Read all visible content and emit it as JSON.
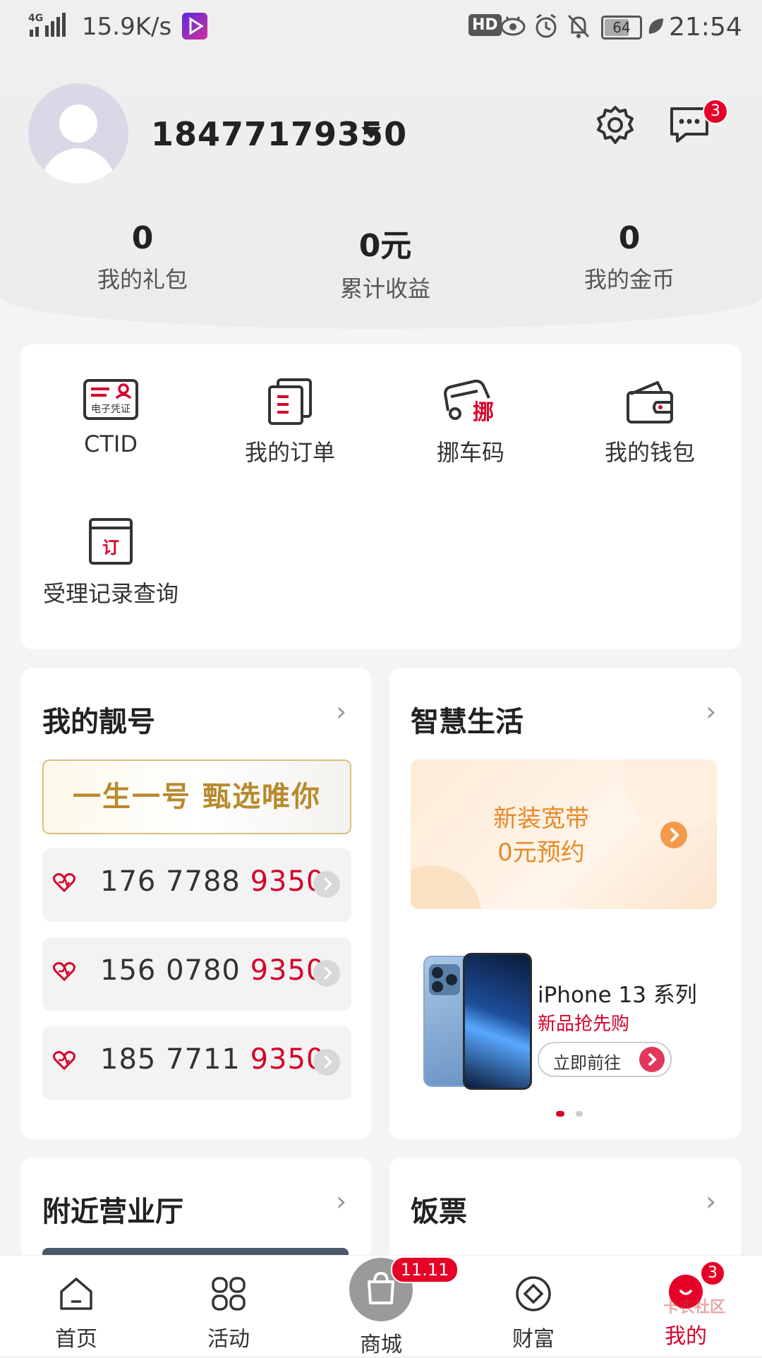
{
  "status_bar": {
    "network": "4G",
    "speed": "15.9K/s",
    "hd": "HD",
    "battery": "64",
    "time": "21:54"
  },
  "profile": {
    "phone": "18477179350",
    "message_badge": "3"
  },
  "stats": [
    {
      "value": "0",
      "label": "我的礼包"
    },
    {
      "value": "0元",
      "label": "累计收益"
    },
    {
      "value": "0",
      "label": "我的金币"
    }
  ],
  "services": [
    {
      "label": "CTID",
      "icon": "e-credential-icon",
      "icon_text": "电子凭证"
    },
    {
      "label": "我的订单",
      "icon": "order-list-icon"
    },
    {
      "label": "挪车码",
      "icon": "move-car-icon",
      "icon_text": "挪"
    },
    {
      "label": "我的钱包",
      "icon": "wallet-icon"
    },
    {
      "label": "受理记录查询",
      "icon": "record-icon",
      "icon_text": "订"
    }
  ],
  "lucky_numbers": {
    "title": "我的靓号",
    "banner": "一生一号 甄选唯你",
    "numbers": [
      {
        "prefix": "176 7788 ",
        "suffix": "9350"
      },
      {
        "prefix": "156 0780 ",
        "suffix": "9350"
      },
      {
        "prefix": "185 7711 ",
        "suffix": "9350"
      }
    ]
  },
  "smart_life": {
    "title": "智慧生活",
    "broadband_line1": "新装宽带",
    "broadband_line2": "0元预约",
    "product_title": "iPhone 13 系列",
    "product_sub": "新品抢先购",
    "product_button": "立即前往"
  },
  "nearby": {
    "title": "附近营业厅"
  },
  "meal": {
    "title": "饭票"
  },
  "tabbar": {
    "items": [
      {
        "label": "首页"
      },
      {
        "label": "活动"
      },
      {
        "label": "商城",
        "badge": "11.11"
      },
      {
        "label": "财富"
      },
      {
        "label": "我的",
        "badge": "3"
      }
    ],
    "watermark": "卡农社区"
  },
  "colors": {
    "accent": "#d6002a",
    "orange": "#e8892a",
    "gold": "#b88a2e"
  }
}
